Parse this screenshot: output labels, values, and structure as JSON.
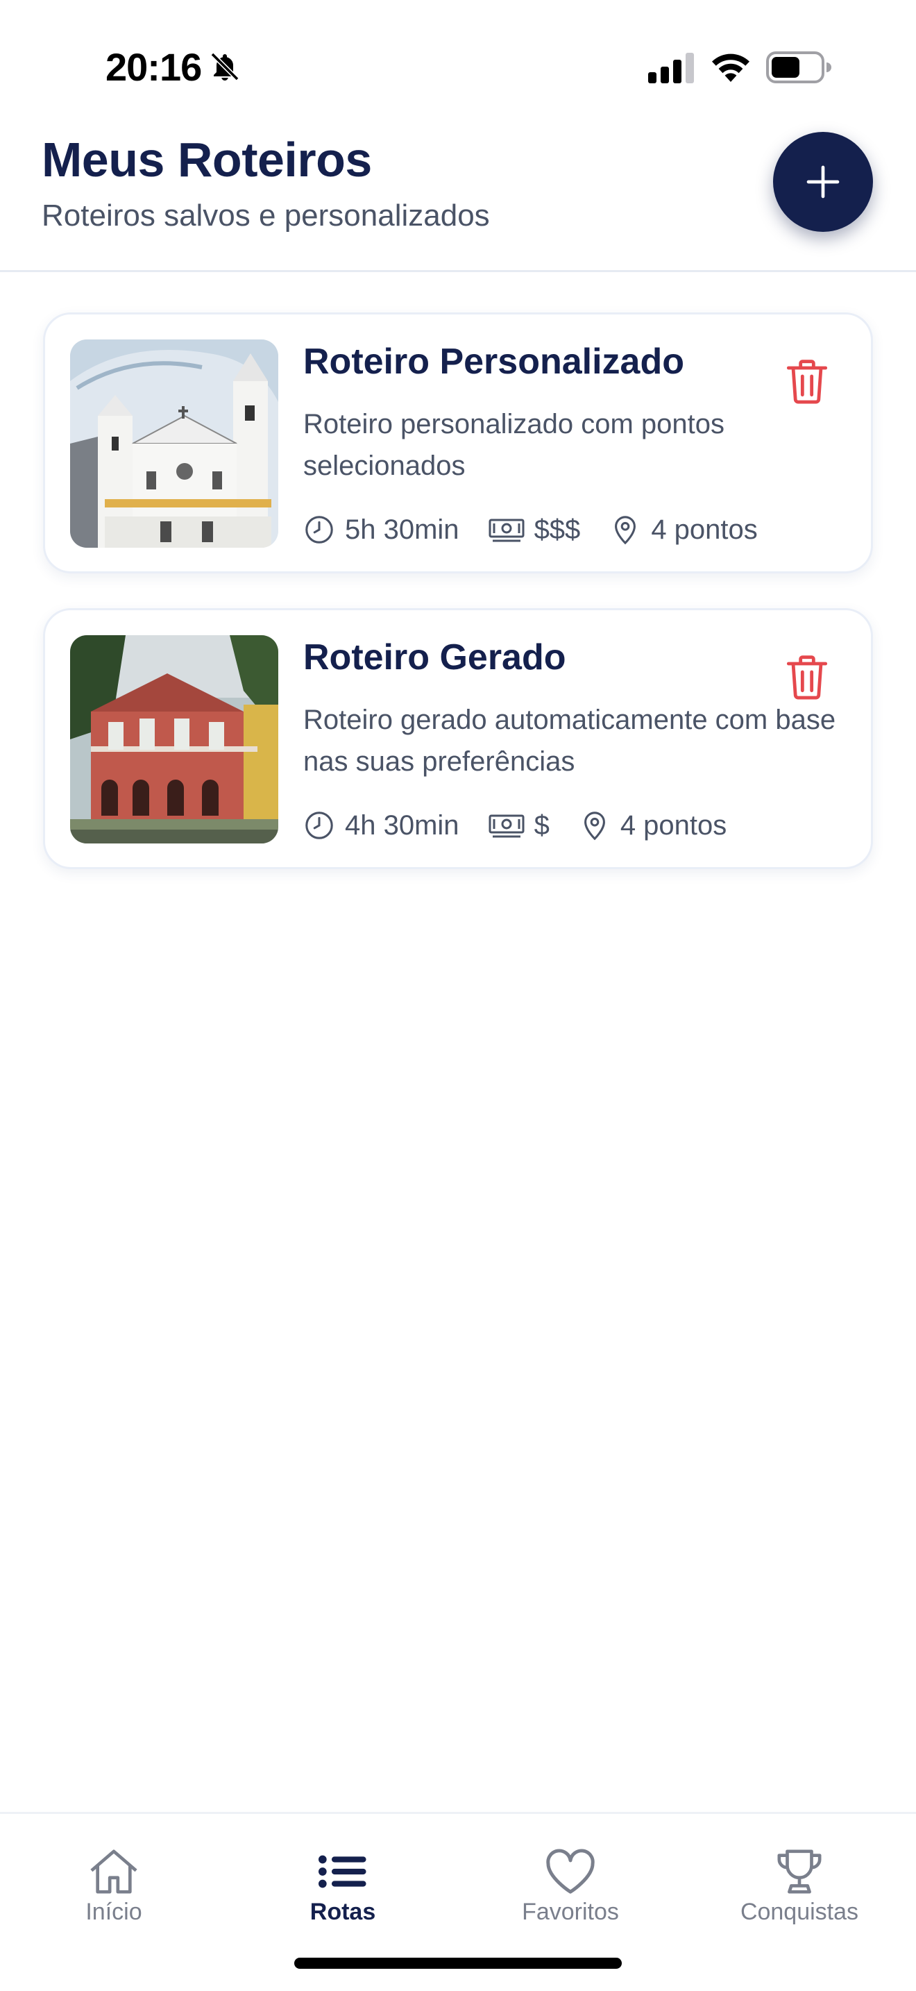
{
  "status_bar": {
    "time": "20:16",
    "icons": [
      "bell-slash-icon",
      "cellular-signal-icon",
      "wifi-icon",
      "battery-icon"
    ]
  },
  "header": {
    "title": "Meus Roteiros",
    "subtitle": "Roteiros salvos e personalizados",
    "add_button_icon": "plus-icon"
  },
  "routes": [
    {
      "title": "Roteiro Personalizado",
      "description": "Roteiro personalizado com pontos selecionados",
      "duration": "5h 30min",
      "price": "$$$",
      "points": "4 pontos",
      "image_icon": "cathedral-photo",
      "delete_icon": "trash-icon"
    },
    {
      "title": "Roteiro Gerado",
      "description": "Roteiro gerado automaticamente com base nas suas preferências",
      "duration": "4h 30min",
      "price": "$",
      "points": "4 pontos",
      "image_icon": "colonial-building-photo",
      "delete_icon": "trash-icon"
    }
  ],
  "tabbar": {
    "tabs": [
      {
        "label": "Início",
        "icon": "home-icon",
        "active": false
      },
      {
        "label": "Rotas",
        "icon": "list-icon",
        "active": true
      },
      {
        "label": "Favoritos",
        "icon": "heart-icon",
        "active": false
      },
      {
        "label": "Conquistas",
        "icon": "trophy-icon",
        "active": false
      }
    ]
  },
  "colors": {
    "primary": "#14204d",
    "danger": "#e5484d",
    "muted_text": "#4a5366",
    "inactive_tab": "#7a7f8c"
  }
}
